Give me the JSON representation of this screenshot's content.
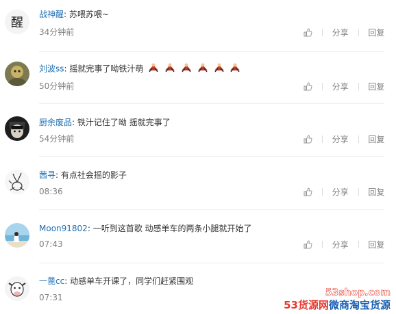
{
  "actions": {
    "share_label": "分享",
    "reply_label": "回复"
  },
  "comments": [
    {
      "username": "战神醒",
      "text": "苏喂苏喂~",
      "time": "34分钟前",
      "avatar_glyph": "醒"
    },
    {
      "username": "刘波ss",
      "text": "摇就完事了呦铁汁萌",
      "time": "50分钟前"
    },
    {
      "username": "厨余废品",
      "text": "铁汁记住了呦 摇就完事了",
      "time": "54分钟前"
    },
    {
      "username": "茜寻",
      "text": "有点社会摇的影子",
      "time": "08:36"
    },
    {
      "username": "Moon91802",
      "text": "一听到这首歌 动感单车的两条小腿就开始了",
      "time": "07:43"
    },
    {
      "username": "一蓖cc",
      "text": "动感单车开课了，同学们赶紧围观",
      "time": "07:31"
    }
  ],
  "watermark": {
    "url": "53shop.com",
    "title_a": "53货源网",
    "title_b": "微商淘宝货源"
  },
  "colors": {
    "username": "#1f6fb2",
    "text": "#333333",
    "meta": "#808080",
    "watermark_red": "#e8392e",
    "watermark_blue": "#1a5fb4"
  }
}
